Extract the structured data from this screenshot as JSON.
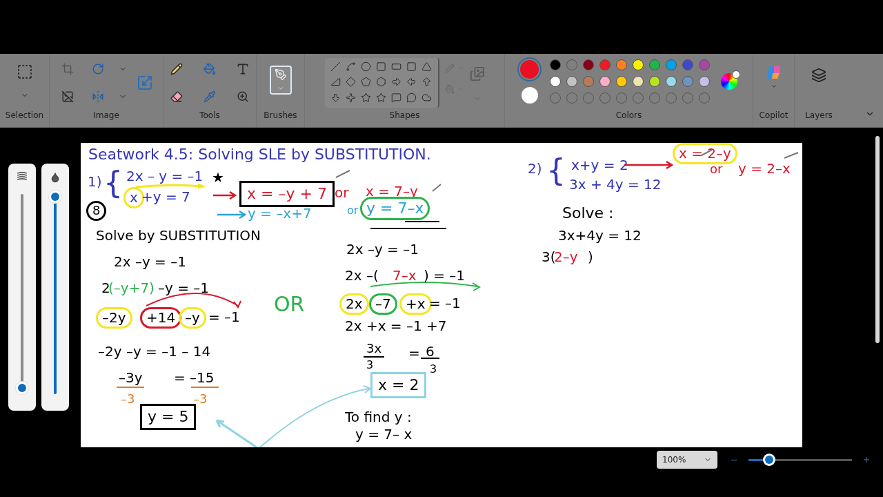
{
  "ribbon": {
    "groups": [
      {
        "label": "Selection"
      },
      {
        "label": "Image"
      },
      {
        "label": "Tools"
      },
      {
        "label": "Brushes"
      },
      {
        "label": "Shapes"
      },
      {
        "label": "Colors"
      },
      {
        "label": "Copilot"
      },
      {
        "label": "Layers"
      }
    ]
  },
  "colors": {
    "current": [
      {
        "color": "#e81123"
      },
      {
        "color": "#ffffff"
      }
    ],
    "palette": [
      {
        "color": "#000000"
      },
      {
        "color": "#7f7f7f"
      },
      {
        "color": "#880015"
      },
      {
        "color": "#ed1c24"
      },
      {
        "color": "#ff7f27"
      },
      {
        "color": "#fff200"
      },
      {
        "color": "#22b14c"
      },
      {
        "color": "#00a2e8"
      },
      {
        "color": "#3f48cc"
      },
      {
        "color": "#a349a4"
      },
      {
        "color": "#ffffff"
      },
      {
        "color": "#c3c3c3"
      },
      {
        "color": "#b97a57"
      },
      {
        "color": "#ffaec9"
      },
      {
        "color": "#ffc90e"
      },
      {
        "color": "#efe4b0"
      },
      {
        "color": "#b5e61d"
      },
      {
        "color": "#99d9ea"
      },
      {
        "color": "#7092be"
      },
      {
        "color": "#c8bfe7"
      }
    ]
  },
  "side_sliders": [
    {
      "kind": "size",
      "level": 0.03
    },
    {
      "kind": "opacity",
      "level": 1
    }
  ],
  "canvas": {
    "items": [
      {
        "text": "Seatwork 4.5: Solving SLE by SUBSTITUTION.",
        "color": "#3535b5"
      },
      {
        "text": "1)",
        "color": "#3535b5"
      },
      {
        "text": "{",
        "color": "#3535b5"
      },
      {
        "text": "2x – y = –1",
        "color": "#3535b5"
      },
      {
        "text": "★",
        "color": "#000000"
      },
      {
        "text": "x",
        "color": "#3535b5",
        "ring": {
          "color": "#f5e622"
        }
      },
      {
        "text": "+y   =   7",
        "color": "#3535b5"
      },
      {
        "text": "8",
        "color": "#000000",
        "ring": {
          "color": "#000000"
        }
      },
      {
        "text": "x = –y + 7",
        "color": "#d7182a",
        "box": {
          "color": "#000000"
        }
      },
      {
        "text": "or",
        "color": "#d7182a"
      },
      {
        "text": "x = 7–y",
        "color": "#d7182a"
      },
      {
        "text": "y = –x+7",
        "color": "#29a3d6"
      },
      {
        "text": "or",
        "color": "#29a3d6"
      },
      {
        "text": "y = 7–x",
        "color": "#29a3d6",
        "ring": {
          "color": "#2cb34a"
        }
      },
      {
        "text": "Solve by SUBSTITUTION",
        "color": "#000000"
      },
      {
        "text": "2x –y = –1",
        "color": "#000000"
      },
      {
        "text": "2",
        "color": "#000000"
      },
      {
        "text": "(–y+7)",
        "color": "#2cb34a"
      },
      {
        "text": "–y = –1",
        "color": "#000000"
      },
      {
        "text": "–2y",
        "color": "#000000",
        "ring": {
          "color": "#f5e622"
        }
      },
      {
        "text": "+14",
        "color": "#000000",
        "ring": {
          "color": "#d7182a"
        }
      },
      {
        "text": "–y",
        "color": "#000000",
        "ring": {
          "color": "#f5e622"
        }
      },
      {
        "text": "= –1",
        "color": "#000000"
      },
      {
        "text": "–2y –y = –1 – 14",
        "color": "#000000"
      },
      {
        "text": "–3y",
        "color": "#000000"
      },
      {
        "text": "= –15",
        "color": "#000000"
      },
      {
        "text": "–3",
        "color": "#e07b22"
      },
      {
        "text": "–3",
        "color": "#e07b22"
      },
      {
        "text": "y = 5",
        "color": "#000000",
        "box": {
          "color": "#000000"
        }
      },
      {
        "text": "OR",
        "color": "#2cb34a"
      },
      {
        "text": "2x –y = –1",
        "color": "#000000"
      },
      {
        "text": "2x –(",
        "color": "#000000"
      },
      {
        "text": "7–x",
        "color": "#d7182a"
      },
      {
        "text": ") = –1",
        "color": "#000000"
      },
      {
        "text": "2x",
        "color": "#000000",
        "ring": {
          "color": "#f5e622"
        }
      },
      {
        "text": "–7",
        "color": "#000000",
        "ring": {
          "color": "#2cb34a"
        }
      },
      {
        "text": "+x",
        "color": "#000000",
        "ring": {
          "color": "#f5e622"
        }
      },
      {
        "text": "= –1",
        "color": "#000000"
      },
      {
        "text": "2x +x   = –1 +7",
        "color": "#000000"
      },
      {
        "text": "3x",
        "color": "#000000"
      },
      {
        "text": "3",
        "color": "#000000"
      },
      {
        "text": "=",
        "color": "#000000"
      },
      {
        "text": "6",
        "color": "#000000"
      },
      {
        "text": "3",
        "color": "#000000"
      },
      {
        "text": "x = 2",
        "color": "#000000",
        "box": {
          "color": "#8fd3e4"
        }
      },
      {
        "text": "To find y :",
        "color": "#000000"
      },
      {
        "text": "y = 7– x",
        "color": "#000000"
      },
      {
        "text": "2)",
        "color": "#3535b5"
      },
      {
        "text": "{",
        "color": "#3535b5"
      },
      {
        "text": "x+y = 2",
        "color": "#3535b5"
      },
      {
        "text": "3x + 4y = 12",
        "color": "#3535b5"
      },
      {
        "text": "x = 2–y",
        "color": "#d7182a",
        "ring": {
          "color": "#f5e622"
        }
      },
      {
        "text": "or",
        "color": "#d7182a"
      },
      {
        "text": "y = 2–x",
        "color": "#d7182a"
      },
      {
        "text": "Solve :",
        "color": "#000000"
      },
      {
        "text": "3x+4y = 12",
        "color": "#000000"
      },
      {
        "text": "3(",
        "color": "#000000"
      },
      {
        "text": "2–y",
        "color": "#d7182a"
      },
      {
        "text": ")",
        "color": "#000000"
      }
    ]
  },
  "status_bar": {
    "zoom": "100%",
    "zoom_slider": {
      "level": 0.2
    }
  }
}
